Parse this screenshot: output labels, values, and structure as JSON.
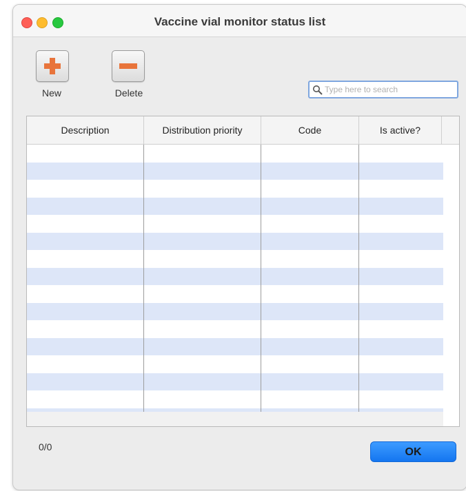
{
  "window": {
    "title": "Vaccine vial monitor status list"
  },
  "toolbar": {
    "new_label": "New",
    "delete_label": "Delete"
  },
  "search": {
    "placeholder": "Type here to search",
    "value": ""
  },
  "table": {
    "columns": [
      "Description",
      "Distribution priority",
      "Code",
      "Is active?"
    ],
    "rows": []
  },
  "footer": {
    "count": "0/0",
    "ok_label": "OK"
  },
  "colors": {
    "accent": "#1476f0",
    "row_alt": "#dde6f8",
    "icon_orange": "#e8743b"
  },
  "icons": {
    "new": "plus-icon",
    "delete": "minus-icon",
    "search": "search-icon"
  }
}
